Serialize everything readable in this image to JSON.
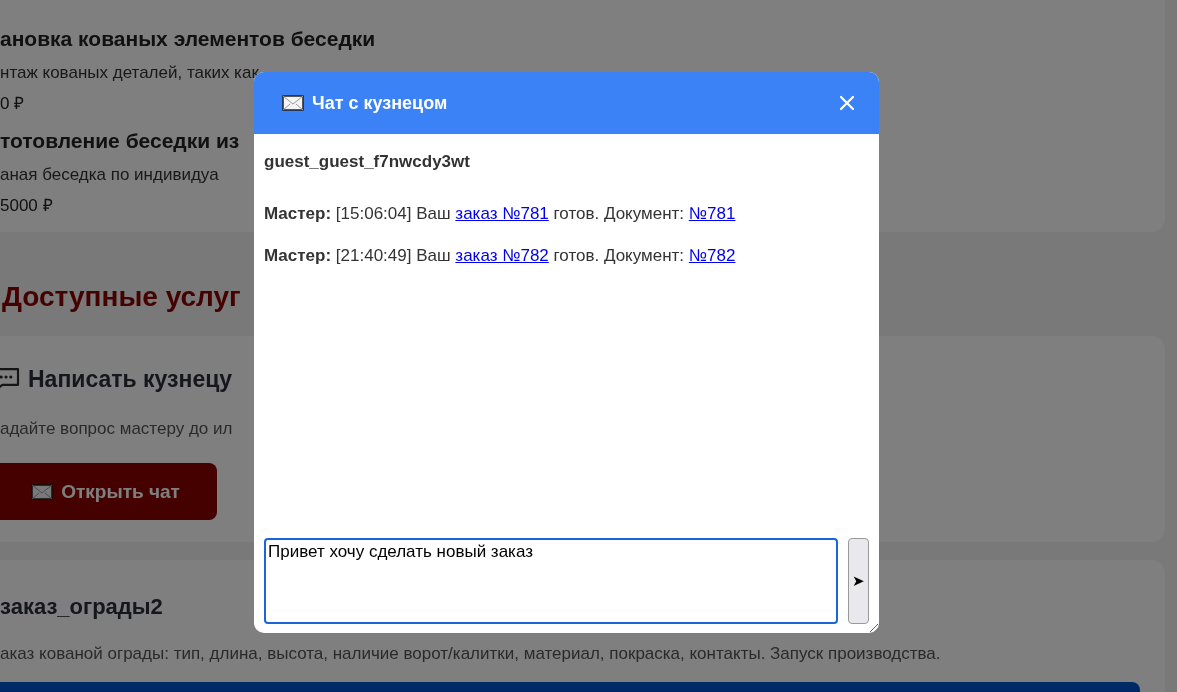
{
  "services": [
    {
      "title": "ановка кованых элементов беседки",
      "description": "нтаж кованых деталей, таких как",
      "price": "0 ₽"
    },
    {
      "title": "тотовление беседки из",
      "description": "аная беседка по индивидуа",
      "price": "5000 ₽"
    }
  ],
  "section_title": "Доступные услуг",
  "contact_card": {
    "title": "Написать кузнецу",
    "description": "адайте вопрос мастеру до ил",
    "button": "Открыть чат"
  },
  "order_card": {
    "title": "заказ_ограды2",
    "description": "аказ кованой ограды: тип, длина, высота, наличие ворот/калитки, материал, покраска, контакты. Запуск производства."
  },
  "chat": {
    "title": "Чат с кузнецом",
    "user": "guest_guest_f7nwcdy3wt",
    "messages": [
      {
        "author": "Мастер:",
        "before": "[15:06:04] Ваш",
        "order_link": "заказ №781",
        "middle": "готов. Документ:",
        "doc_link": "№781"
      },
      {
        "author": "Мастер:",
        "before": "[21:40:49] Ваш",
        "order_link": "заказ №782",
        "middle": "готов. Документ:",
        "doc_link": "№782"
      }
    ],
    "input": {
      "value": "Привет хочу сделать новый заказ"
    },
    "send": "➤"
  }
}
